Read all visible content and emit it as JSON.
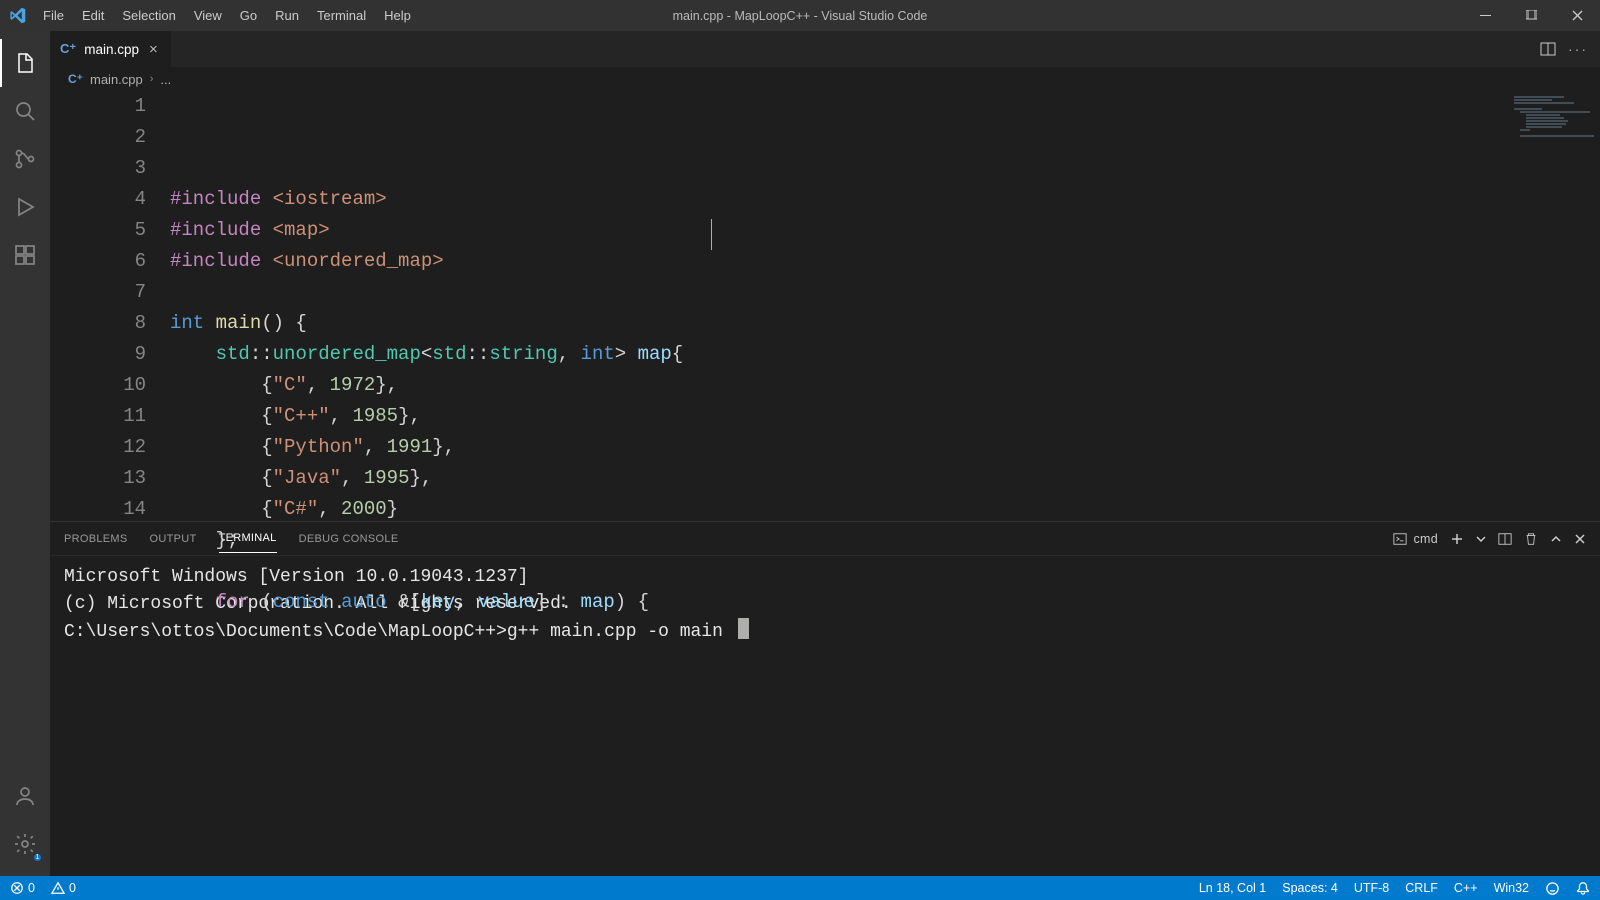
{
  "title": "main.cpp - MapLoopC++ - Visual Studio Code",
  "menu": [
    "File",
    "Edit",
    "Selection",
    "View",
    "Go",
    "Run",
    "Terminal",
    "Help"
  ],
  "tab": {
    "filename": "main.cpp"
  },
  "breadcrumb": {
    "filename": "main.cpp",
    "rest": "..."
  },
  "code_lines": [
    {
      "n": 1,
      "segs": [
        [
          "tok-pp",
          "#include "
        ],
        [
          "tok-inc",
          "<iostream>"
        ]
      ]
    },
    {
      "n": 2,
      "segs": [
        [
          "tok-pp",
          "#include "
        ],
        [
          "tok-inc",
          "<map>"
        ]
      ]
    },
    {
      "n": 3,
      "segs": [
        [
          "tok-pp",
          "#include "
        ],
        [
          "tok-inc",
          "<unordered_map>"
        ]
      ]
    },
    {
      "n": 4,
      "segs": []
    },
    {
      "n": 5,
      "segs": [
        [
          "tok-kw",
          "int "
        ],
        [
          "tok-fn",
          "main"
        ],
        [
          "tok-op",
          "() {"
        ]
      ]
    },
    {
      "n": 6,
      "segs": [
        [
          "tok-op",
          "    "
        ],
        [
          "tok-type",
          "std"
        ],
        [
          "tok-op",
          "::"
        ],
        [
          "tok-type",
          "unordered_map"
        ],
        [
          "tok-op",
          "<"
        ],
        [
          "tok-type",
          "std"
        ],
        [
          "tok-op",
          "::"
        ],
        [
          "tok-type",
          "string"
        ],
        [
          "tok-op",
          ", "
        ],
        [
          "tok-kw",
          "int"
        ],
        [
          "tok-op",
          "> "
        ],
        [
          "tok-var",
          "map"
        ],
        [
          "tok-op",
          "{"
        ]
      ]
    },
    {
      "n": 7,
      "segs": [
        [
          "tok-op",
          "        {"
        ],
        [
          "tok-str",
          "\"C\""
        ],
        [
          "tok-op",
          ", "
        ],
        [
          "tok-num",
          "1972"
        ],
        [
          "tok-op",
          "},"
        ]
      ]
    },
    {
      "n": 8,
      "segs": [
        [
          "tok-op",
          "        {"
        ],
        [
          "tok-str",
          "\"C++\""
        ],
        [
          "tok-op",
          ", "
        ],
        [
          "tok-num",
          "1985"
        ],
        [
          "tok-op",
          "},"
        ]
      ]
    },
    {
      "n": 9,
      "segs": [
        [
          "tok-op",
          "        {"
        ],
        [
          "tok-str",
          "\"Python\""
        ],
        [
          "tok-op",
          ", "
        ],
        [
          "tok-num",
          "1991"
        ],
        [
          "tok-op",
          "},"
        ]
      ]
    },
    {
      "n": 10,
      "segs": [
        [
          "tok-op",
          "        {"
        ],
        [
          "tok-str",
          "\"Java\""
        ],
        [
          "tok-op",
          ", "
        ],
        [
          "tok-num",
          "1995"
        ],
        [
          "tok-op",
          "},"
        ]
      ]
    },
    {
      "n": 11,
      "segs": [
        [
          "tok-op",
          "        {"
        ],
        [
          "tok-str",
          "\"C#\""
        ],
        [
          "tok-op",
          ", "
        ],
        [
          "tok-num",
          "2000"
        ],
        [
          "tok-op",
          "}"
        ]
      ]
    },
    {
      "n": 12,
      "segs": [
        [
          "tok-op",
          "    };"
        ]
      ]
    },
    {
      "n": 13,
      "segs": []
    },
    {
      "n": 14,
      "segs": [
        [
          "tok-op",
          "    "
        ],
        [
          "tok-ctrl",
          "for"
        ],
        [
          "tok-op",
          " ("
        ],
        [
          "tok-kw",
          "const "
        ],
        [
          "tok-kw",
          "auto"
        ],
        [
          "tok-op",
          " &["
        ],
        [
          "tok-var",
          "key"
        ],
        [
          "tok-op",
          ", "
        ],
        [
          "tok-var",
          "value"
        ],
        [
          "tok-op",
          "] : "
        ],
        [
          "tok-var",
          "map"
        ],
        [
          "tok-op",
          ") {"
        ]
      ]
    }
  ],
  "panel": {
    "tabs": [
      "PROBLEMS",
      "OUTPUT",
      "TERMINAL",
      "DEBUG CONSOLE"
    ],
    "active_tab": "TERMINAL",
    "shell_label": "cmd",
    "terminal_lines": [
      "Microsoft Windows [Version 10.0.19043.1237]",
      "(c) Microsoft Corporation. All rights reserved.",
      "",
      "C:\\Users\\ottos\\Documents\\Code\\MapLoopC++>g++ main.cpp -o main "
    ]
  },
  "status": {
    "errors": "0",
    "warnings": "0",
    "ln_col": "Ln 18, Col 1",
    "spaces": "Spaces: 4",
    "encoding": "UTF-8",
    "eol": "CRLF",
    "lang": "C++",
    "target": "Win32"
  }
}
